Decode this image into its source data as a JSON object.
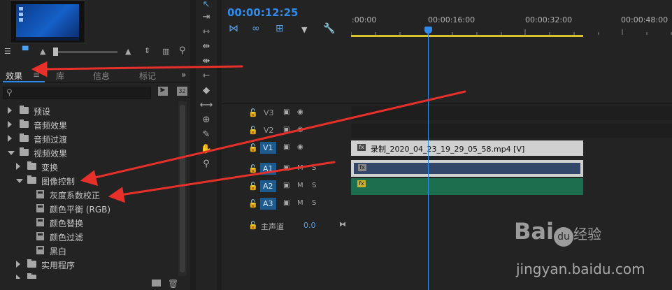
{
  "left_panel": {
    "tabs": [
      {
        "label": "效果",
        "active": true
      },
      {
        "label": "库",
        "active": false
      },
      {
        "label": "信息",
        "active": false
      },
      {
        "label": "标记",
        "active": false
      }
    ],
    "tab_menu": "≡",
    "more": "»",
    "tree": [
      {
        "label": "预设",
        "indent": 0,
        "expanded": false,
        "icon": "folder-star-icon"
      },
      {
        "label": "音频效果",
        "indent": 0,
        "expanded": false,
        "icon": "folder-icon"
      },
      {
        "label": "音频过渡",
        "indent": 0,
        "expanded": false,
        "icon": "folder-icon"
      },
      {
        "label": "视频效果",
        "indent": 0,
        "expanded": true,
        "icon": "folder-icon"
      },
      {
        "label": "变换",
        "indent": 1,
        "expanded": false,
        "icon": "folder-icon"
      },
      {
        "label": "图像控制",
        "indent": 1,
        "expanded": true,
        "icon": "folder-icon"
      },
      {
        "label": "灰度系数校正",
        "indent": 2,
        "icon": "effect-icon"
      },
      {
        "label": "颜色平衡 (RGB)",
        "indent": 2,
        "icon": "effect-icon"
      },
      {
        "label": "颜色替换",
        "indent": 2,
        "icon": "effect-icon"
      },
      {
        "label": "颜色过滤",
        "indent": 2,
        "icon": "effect-icon"
      },
      {
        "label": "黑白",
        "indent": 2,
        "icon": "effect-icon"
      },
      {
        "label": "实用程序",
        "indent": 1,
        "expanded": false,
        "icon": "folder-icon"
      }
    ]
  },
  "timeline": {
    "timecode": "00:00:12:25",
    "ruler_labels": [
      ":00:00",
      "00:00:16:00",
      "00:00:32:00",
      "00:00:48:00"
    ],
    "tracks": [
      {
        "name": "V3",
        "active": false,
        "type": "video"
      },
      {
        "name": "V2",
        "active": false,
        "type": "video"
      },
      {
        "name": "V1",
        "active": true,
        "type": "video"
      },
      {
        "name": "A1",
        "active": true,
        "type": "audio"
      },
      {
        "name": "A2",
        "active": true,
        "type": "audio"
      },
      {
        "name": "A3",
        "active": true,
        "type": "audio"
      }
    ],
    "master_label": "主声道",
    "master_value": "0.0",
    "clip_video_label": "录制_2020_04_23_19_29_05_58.mp4 [V]",
    "fx_label": "fx",
    "m_label": "M",
    "s_label": "S"
  },
  "watermark": {
    "brand_text": "Bai",
    "brand_du": "du",
    "brand_cn": "经验",
    "url": "jingyan.baidu.com"
  },
  "colors": {
    "accent": "#2d8ceb",
    "annotation_arrow": "#e8302a",
    "work_area": "#d8c12a",
    "audio_clip": "#1d6e4e"
  }
}
